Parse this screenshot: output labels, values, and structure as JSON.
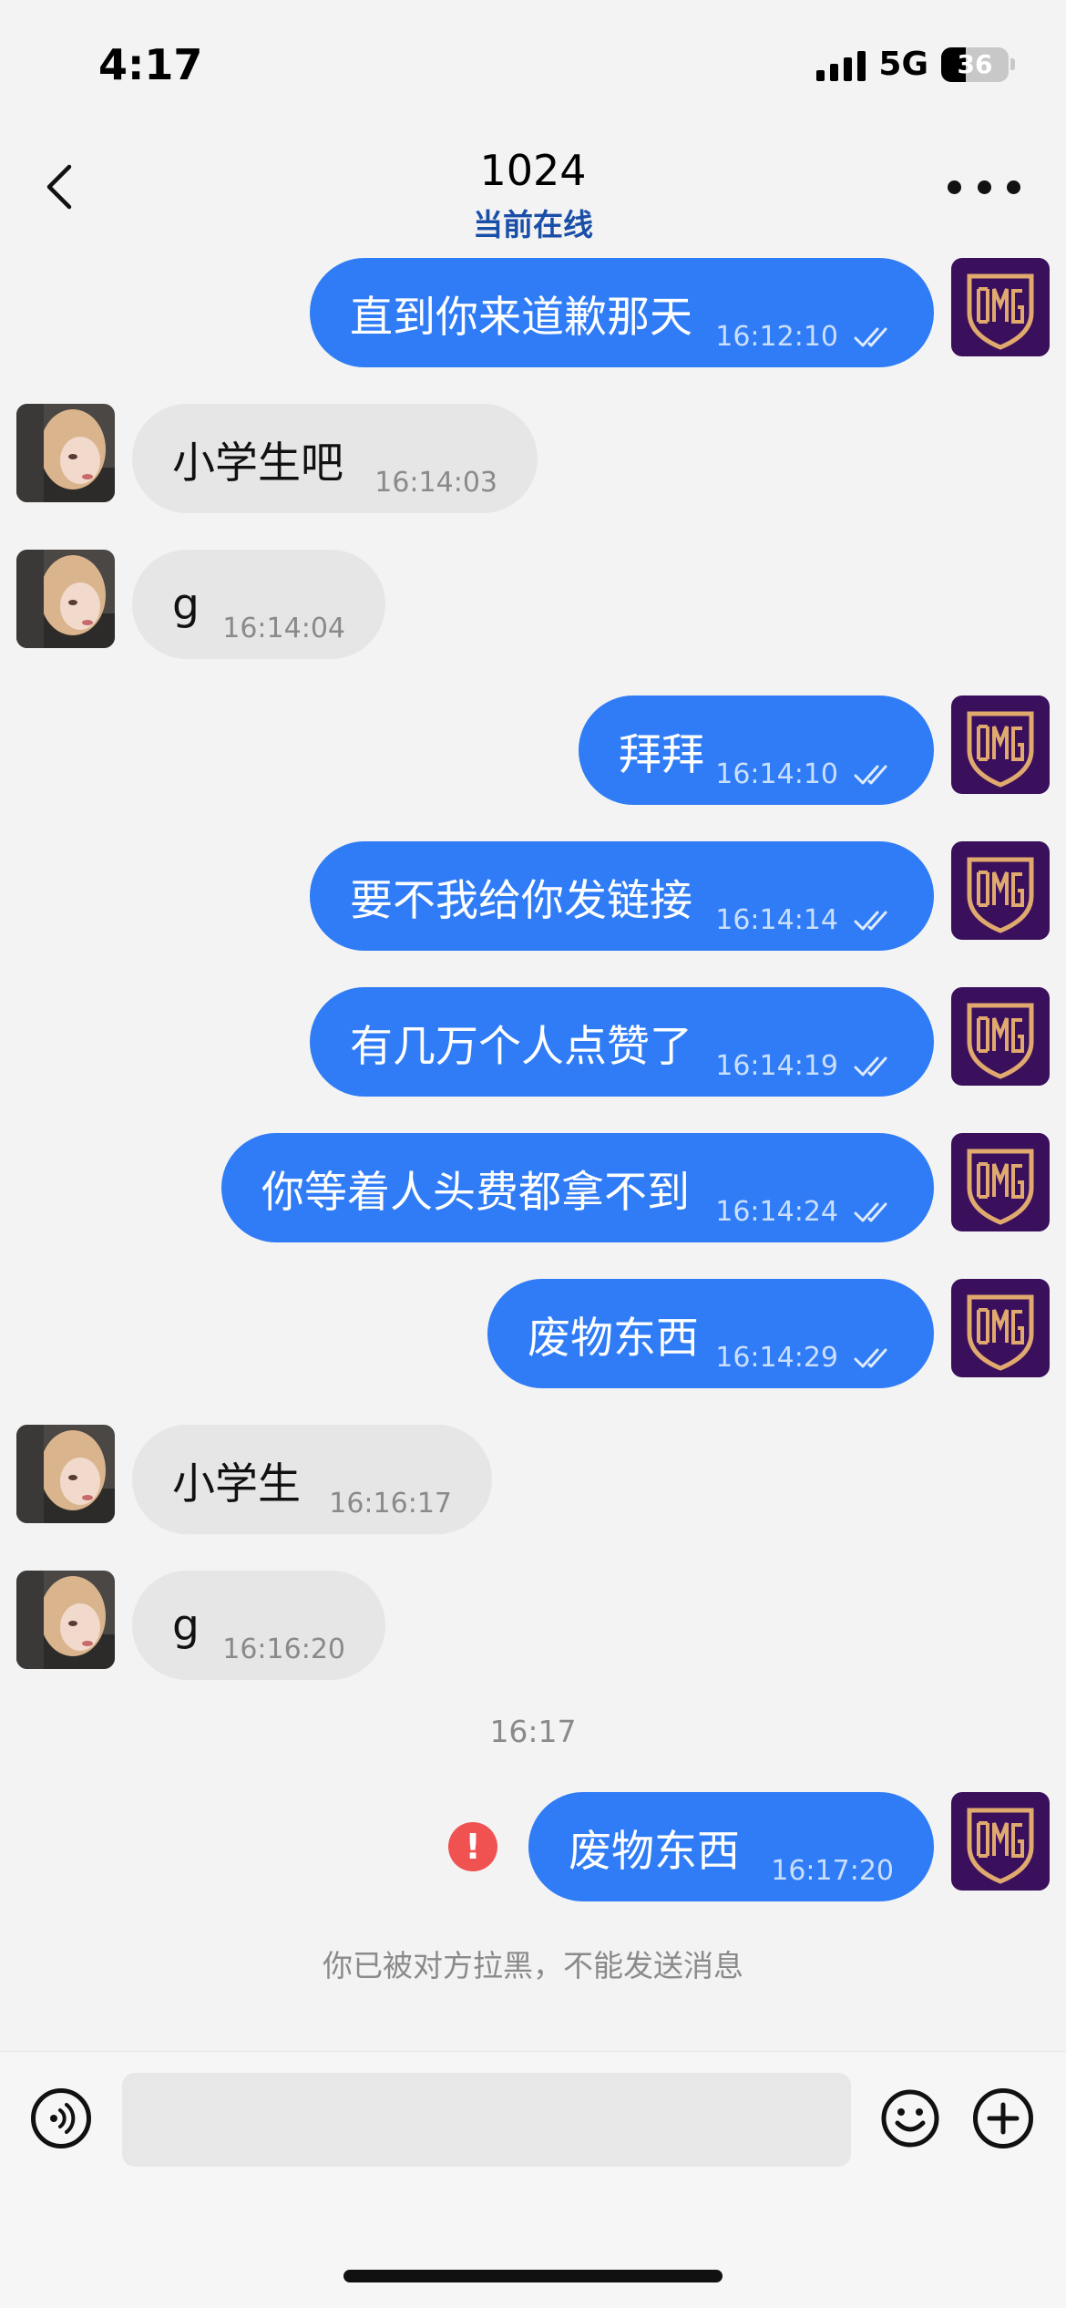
{
  "status_bar": {
    "time": "4:17",
    "network": "5G",
    "battery": "36",
    "battery_level": 0.36
  },
  "header": {
    "title": "1024",
    "subtitle": "当前在线"
  },
  "messages": [
    {
      "text": "直到你来道歉那天",
      "time": "16:12:10",
      "sender": "me",
      "status": "read"
    },
    {
      "text": "小学生吧",
      "time": "16:14:03",
      "sender": "other"
    },
    {
      "text": "g",
      "time": "16:14:04",
      "sender": "other"
    },
    {
      "text": "拜拜",
      "time": "16:14:10",
      "sender": "me",
      "status": "read"
    },
    {
      "text": "要不我给你发链接",
      "time": "16:14:14",
      "sender": "me",
      "status": "read"
    },
    {
      "text": "有几万个人点赞了",
      "time": "16:14:19",
      "sender": "me",
      "status": "read"
    },
    {
      "text": "你等着人头费都拿不到",
      "time": "16:14:24",
      "sender": "me",
      "status": "read"
    },
    {
      "text": "废物东西",
      "time": "16:14:29",
      "sender": "me",
      "status": "read"
    },
    {
      "text": "小学生",
      "time": "16:16:17",
      "sender": "other"
    },
    {
      "text": "g",
      "time": "16:16:20",
      "sender": "other"
    },
    {
      "text": "废物东西",
      "time": "16:17:20",
      "sender": "me",
      "status": "failed"
    }
  ],
  "time_divider": "16:17",
  "system_notice": "你已被对方拉黑，不能发送消息",
  "input": {
    "placeholder": "",
    "value": ""
  },
  "icons": {
    "back": "chevron-left-icon",
    "more": "more-dots-icon",
    "voice": "voice-icon",
    "emoji": "emoji-icon",
    "plus": "plus-icon",
    "read": "double-check-icon",
    "failed": "error-icon"
  },
  "colors": {
    "my_bubble": "#2f7cf6",
    "their_bubble": "#e6e6e6",
    "subtitle": "#1a4fa8",
    "error": "#f05252",
    "avatar_mine_bg": "#3a0f5c",
    "avatar_mine_logo": "#e0a96d"
  }
}
